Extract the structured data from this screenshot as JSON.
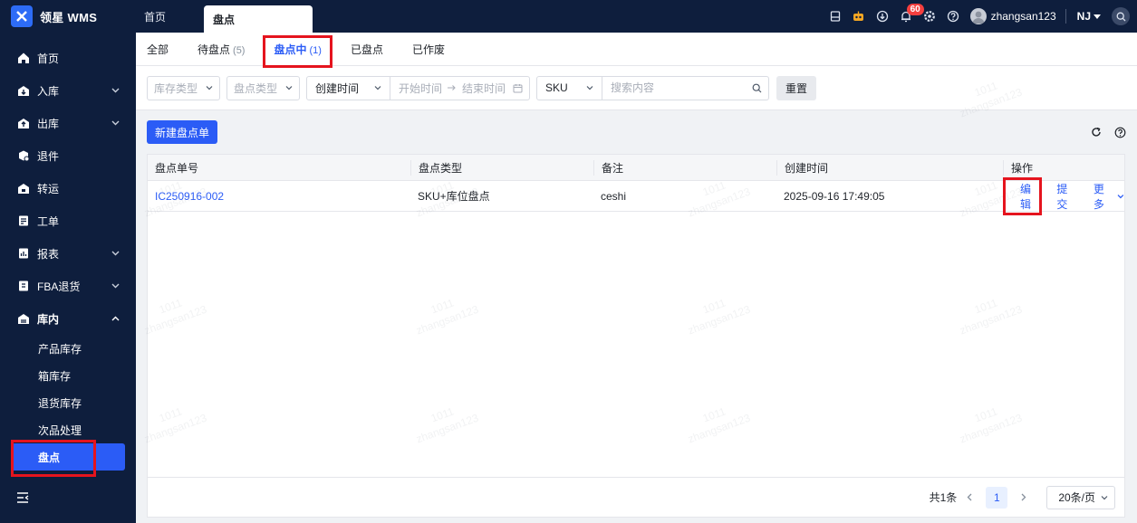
{
  "app": {
    "title": "领星 WMS"
  },
  "top_tabs": [
    {
      "label": "首页"
    },
    {
      "label": "盘点"
    }
  ],
  "notifications": {
    "count": "60"
  },
  "user": {
    "name": "zhangsan123",
    "org": "NJ"
  },
  "sidebar": {
    "items": [
      {
        "label": "首页",
        "icon": "home-icon"
      },
      {
        "label": "入库",
        "icon": "inbound-icon"
      },
      {
        "label": "出库",
        "icon": "outbound-icon"
      },
      {
        "label": "退件",
        "icon": "return-icon"
      },
      {
        "label": "转运",
        "icon": "transfer-icon"
      },
      {
        "label": "工单",
        "icon": "workorder-icon"
      },
      {
        "label": "报表",
        "icon": "report-icon"
      },
      {
        "label": "FBA退货",
        "icon": "fba-return-icon"
      },
      {
        "label": "库内",
        "icon": "warehouse-icon"
      }
    ],
    "submenu": [
      {
        "label": "产品库存"
      },
      {
        "label": "箱库存"
      },
      {
        "label": "退货库存"
      },
      {
        "label": "次品处理"
      },
      {
        "label": "盘点"
      }
    ]
  },
  "status_tabs": [
    {
      "label": "全部",
      "count": ""
    },
    {
      "label": "待盘点",
      "count": "(5)"
    },
    {
      "label": "盘点中",
      "count": "(1)"
    },
    {
      "label": "已盘点",
      "count": ""
    },
    {
      "label": "已作废",
      "count": ""
    }
  ],
  "filters": {
    "stock_type_placeholder": "库存类型",
    "count_type_placeholder": "盘点类型",
    "time_field": "创建时间",
    "start_placeholder": "开始时间",
    "end_placeholder": "结束时间",
    "search_field": "SKU",
    "search_placeholder": "搜索内容",
    "reset_label": "重置"
  },
  "toolbar": {
    "new_label": "新建盘点单"
  },
  "table": {
    "columns": [
      "盘点单号",
      "盘点类型",
      "备注",
      "创建时间",
      "操作"
    ],
    "rows": [
      {
        "id": "IC250916-002",
        "type": "SKU+库位盘点",
        "note": "ceshi",
        "created": "2025-09-16 17:49:05",
        "actions": {
          "edit": "编辑",
          "submit": "提交",
          "more": "更多"
        }
      }
    ]
  },
  "pagination": {
    "total": "共1条",
    "page": "1",
    "page_size": "20条/页"
  },
  "watermark": {
    "line1": "1011",
    "line2": "zhangsan123"
  },
  "colors": {
    "sidebar_bg": "#0e1e3d",
    "accent": "#2b5cf6",
    "highlight": "#e5141e",
    "badge": "#f53f3f"
  }
}
